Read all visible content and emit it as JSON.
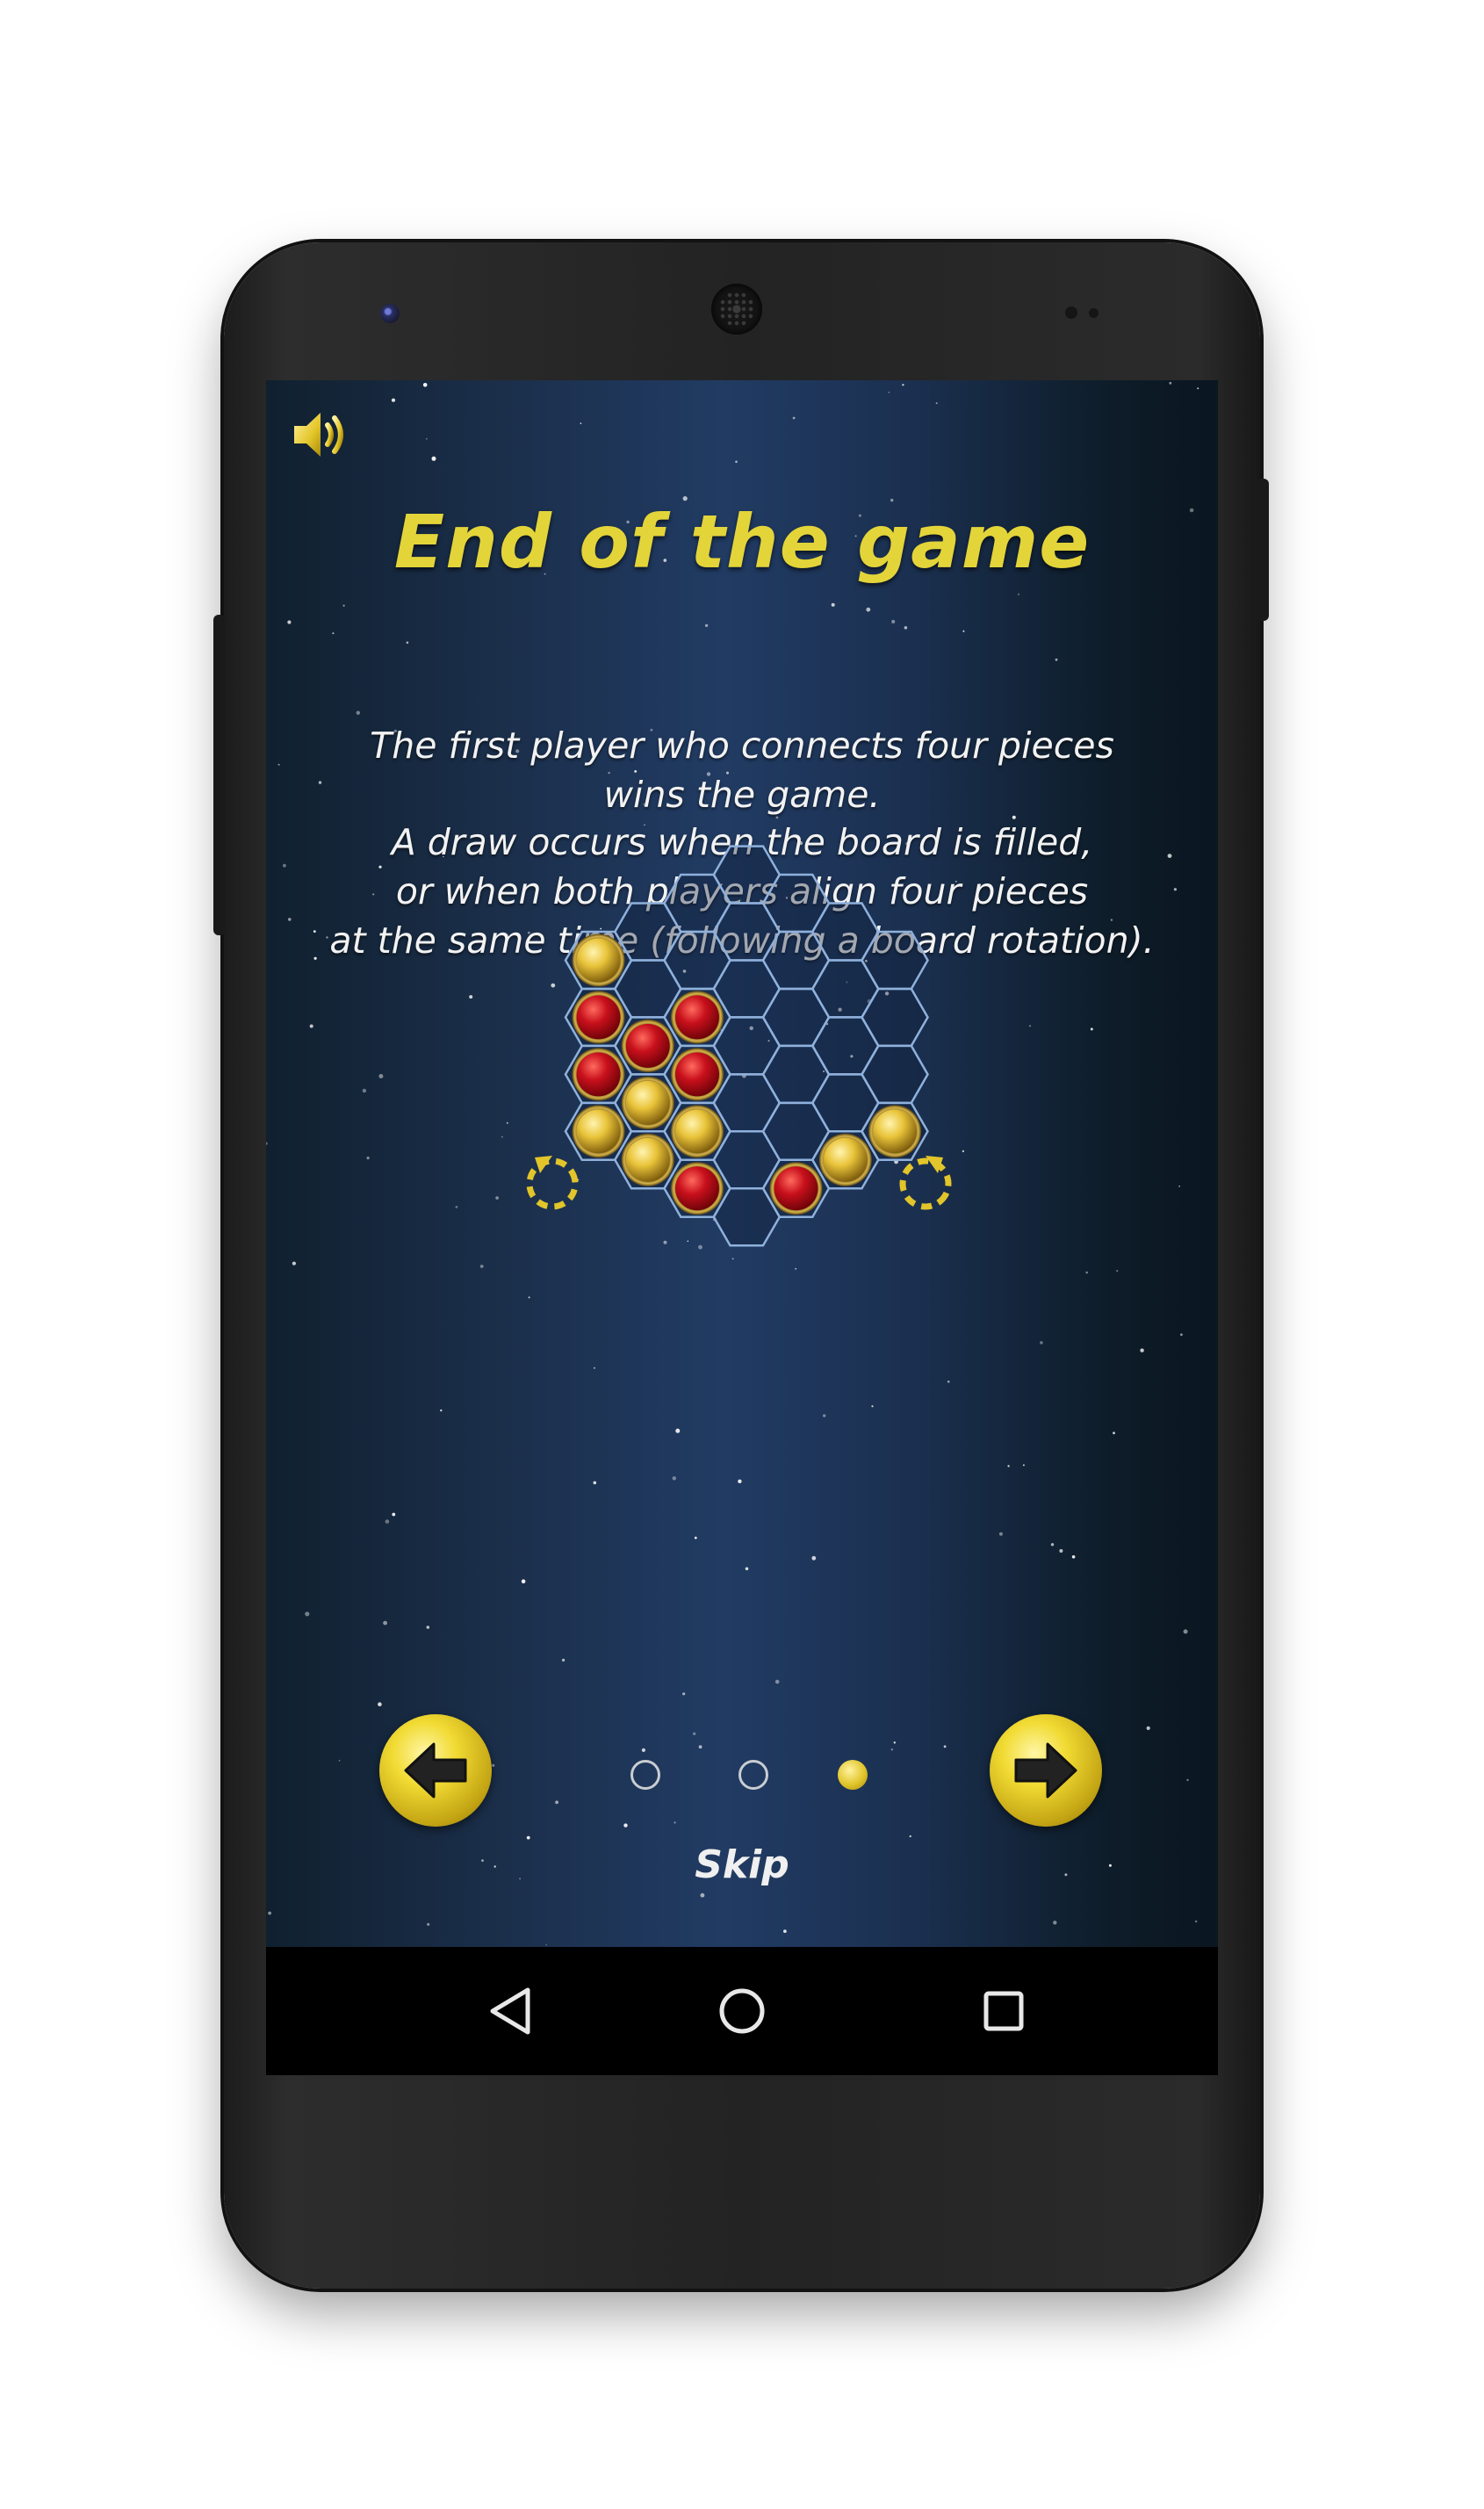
{
  "screen": {
    "title": "End of the game",
    "paragraph_1": [
      "The first player who connects four pieces",
      "wins the game."
    ],
    "paragraph_2": [
      "A draw occurs when the board is filled,",
      "or when both players align four pieces",
      "at the same time (following a board rotation)."
    ],
    "skip_label": "Skip"
  },
  "icons": {
    "sound": "speaker-volume-icon",
    "rotate_left": "rotate-counterclockwise-icon",
    "rotate_right": "rotate-clockwise-icon",
    "previous": "arrow-left-icon",
    "next": "arrow-right-icon",
    "nav_back": "triangle-back-icon",
    "nav_home": "circle-home-icon",
    "nav_recents": "square-recents-icon"
  },
  "board": {
    "columns": 7,
    "column_lengths": [
      4,
      5,
      6,
      7,
      6,
      5,
      4
    ],
    "pieces": [
      {
        "col": 0,
        "row": 0,
        "color": "yellow"
      },
      {
        "col": 0,
        "row": 1,
        "color": "red"
      },
      {
        "col": 0,
        "row": 2,
        "color": "red"
      },
      {
        "col": 0,
        "row": 3,
        "color": "yellow"
      },
      {
        "col": 1,
        "row": 2,
        "color": "red"
      },
      {
        "col": 1,
        "row": 3,
        "color": "yellow"
      },
      {
        "col": 1,
        "row": 4,
        "color": "yellow"
      },
      {
        "col": 2,
        "row": 2,
        "color": "red"
      },
      {
        "col": 2,
        "row": 3,
        "color": "red"
      },
      {
        "col": 2,
        "row": 4,
        "color": "yellow"
      },
      {
        "col": 2,
        "row": 5,
        "color": "red"
      },
      {
        "col": 4,
        "row": 5,
        "color": "red"
      },
      {
        "col": 5,
        "row": 4,
        "color": "yellow"
      },
      {
        "col": 6,
        "row": 3,
        "color": "yellow"
      }
    ]
  },
  "pagination": {
    "total": 3,
    "current": 3
  },
  "colors": {
    "title": "#e3d43a",
    "red_piece": "#c8101c",
    "yellow_piece": "#e9c43a",
    "hex_line": "#8fb1dc",
    "gold": "#e8cc2c"
  }
}
